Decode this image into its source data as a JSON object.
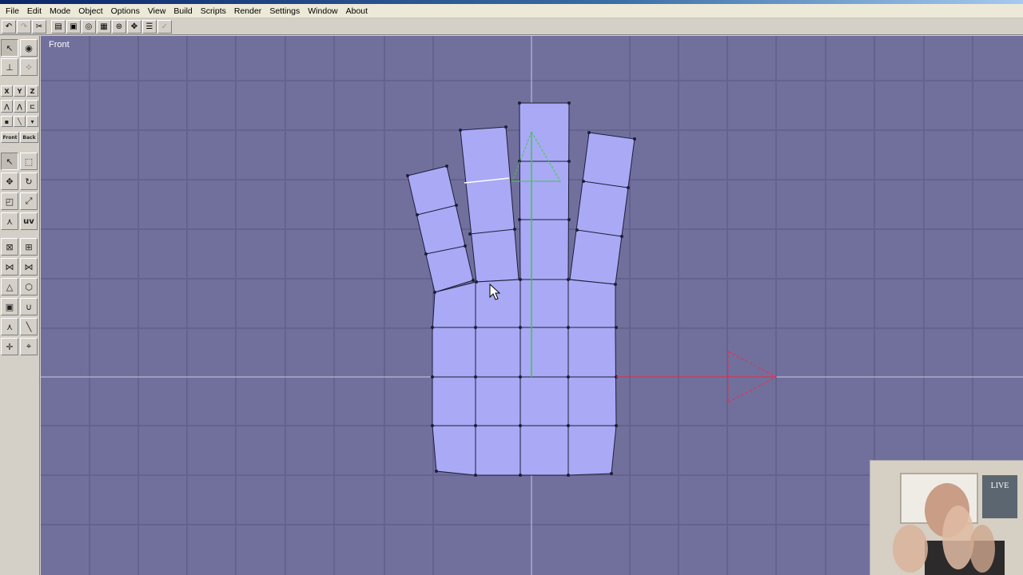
{
  "menu": [
    "File",
    "Edit",
    "Mode",
    "Object",
    "Options",
    "View",
    "Build",
    "Scripts",
    "Render",
    "Settings",
    "Window",
    "About"
  ],
  "viewport": {
    "label": "Front"
  },
  "axes": [
    "X",
    "Y",
    "Z"
  ],
  "toolpanel": {
    "front_label": "Front",
    "back_label": "Back",
    "uv_label": "uv"
  },
  "webcam": {
    "poster_text": "LIVE"
  },
  "colors": {
    "viewport_bg": "#71709d",
    "mesh_fill": "#a9a9f5",
    "y_axis": "#3ccc3c",
    "x_axis": "#e03050"
  }
}
